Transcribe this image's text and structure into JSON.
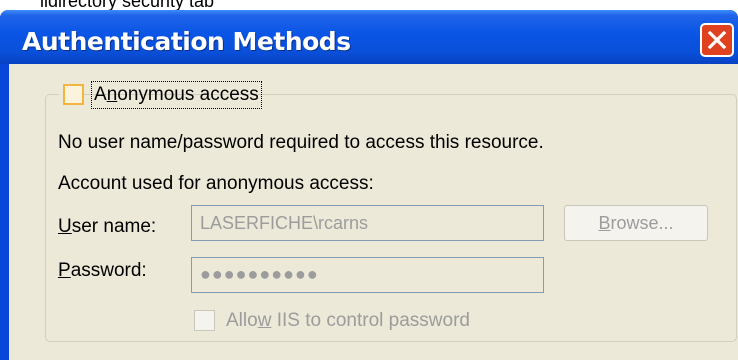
{
  "top_fragment": "ildirectory security tab",
  "dialog": {
    "title": "Authentication Methods",
    "close_icon": "close-icon"
  },
  "anonymous": {
    "checkbox_checked": false,
    "label_prefix": "A",
    "label_access_key": "n",
    "label_rest": "onymous access",
    "description": "No user name/password required to access this resource.",
    "account_label": "Account used for anonymous access:"
  },
  "user_name": {
    "label_access_key": "U",
    "label_rest": "ser name:",
    "value": "LASERFICHE\\rcarns"
  },
  "password": {
    "label_access_key": "P",
    "label_rest": "assword:",
    "masked_value": "●●●●●●●●●●"
  },
  "browse_button": {
    "label_access_key": "B",
    "label_rest": "rowse..."
  },
  "allow_iis": {
    "checked": false,
    "label_prefix": "Allo",
    "label_access_key": "w",
    "label_rest": " IIS to control password"
  }
}
